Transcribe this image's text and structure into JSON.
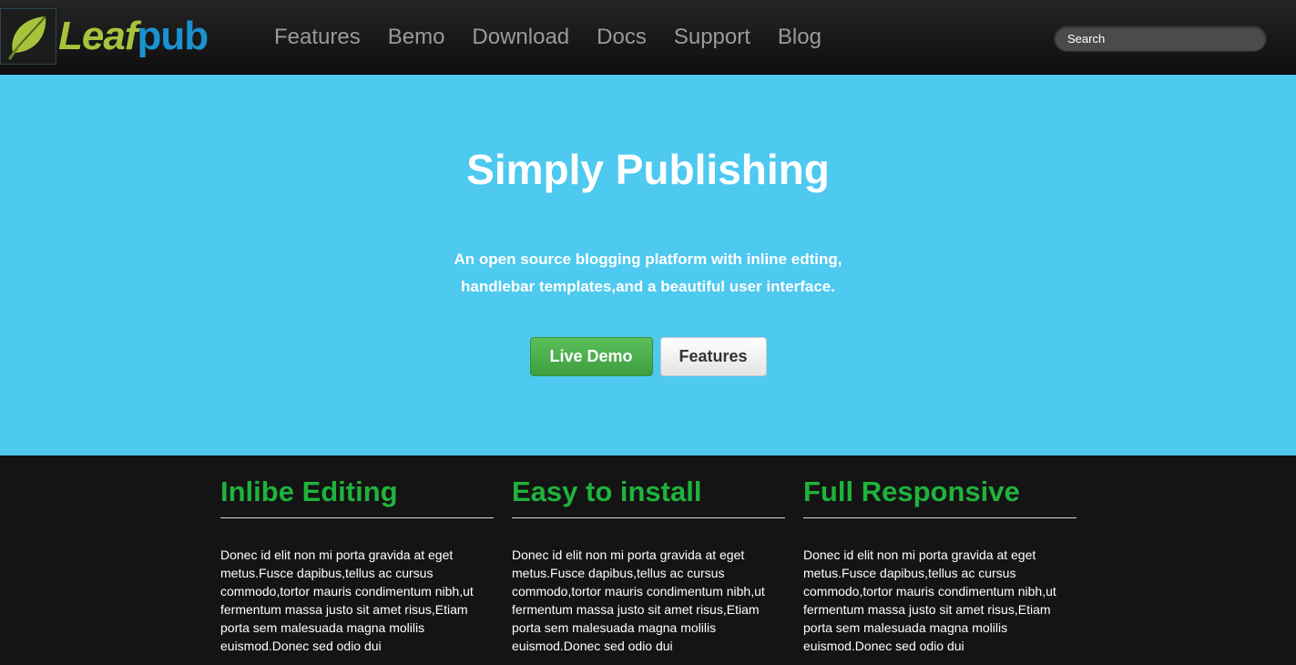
{
  "brand": {
    "name_part1": "Leaf",
    "name_part2": "pub",
    "icon": "leaf-icon",
    "colors": {
      "leaf": "#a7c33c",
      "pub": "#1a92cf"
    }
  },
  "nav": {
    "items": [
      {
        "label": "Features"
      },
      {
        "label": "Bemo"
      },
      {
        "label": "Download"
      },
      {
        "label": "Docs"
      },
      {
        "label": "Support"
      },
      {
        "label": "Blog"
      }
    ]
  },
  "search": {
    "placeholder": "Search",
    "value": ""
  },
  "hero": {
    "title": "Simply Publishing",
    "subtitle_line1": "An open source blogging platform with inline edting,",
    "subtitle_line2": "handlebar templates,and a beautiful user interface.",
    "primary_button": "Live Demo",
    "secondary_button": "Features",
    "background_color": "#4ec9ef"
  },
  "features": [
    {
      "title": "Inlibe Editing",
      "text": "Donec id elit non mi porta gravida at eget metus.Fusce dapibus,tellus ac cursus commodo,tortor mauris condimentum nibh,ut fermentum massa justo sit amet risus,Etiam porta sem malesuada magna molilis euismod.Donec sed odio dui"
    },
    {
      "title": "Easy to install",
      "text": "Donec id elit non mi porta gravida at eget metus.Fusce dapibus,tellus ac cursus commodo,tortor mauris condimentum nibh,ut fermentum massa justo sit amet risus,Etiam porta sem malesuada magna molilis euismod.Donec sed odio dui"
    },
    {
      "title": "Full Responsive",
      "text": "Donec id elit non mi porta gravida at eget metus.Fusce dapibus,tellus ac cursus commodo,tortor mauris condimentum nibh,ut fermentum massa justo sit amet risus,Etiam porta sem malesuada magna molilis euismod.Donec sed odio dui"
    }
  ],
  "colors": {
    "navbar": "#1a1a1a",
    "feature_title": "#1fb33b",
    "demo_button": "#4cae4c"
  }
}
